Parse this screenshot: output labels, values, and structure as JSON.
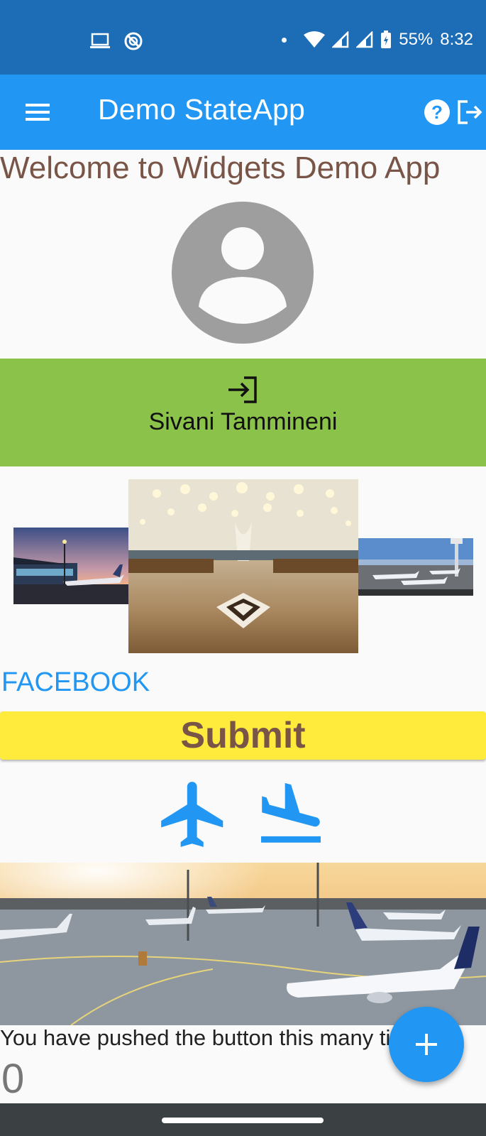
{
  "status_bar": {
    "battery": "55%",
    "time": "8:32",
    "icons": [
      "laptop-icon",
      "sync-disabled-icon",
      "notification-dot-icon",
      "wifi-icon",
      "signal-icon",
      "signal-icon",
      "battery-icon"
    ]
  },
  "app_bar": {
    "title": "Demo StateApp",
    "icons": [
      "menu-icon",
      "help-icon",
      "logout-icon"
    ]
  },
  "welcome_text": "Welcome to Widgets Demo App",
  "login_card": {
    "icon": "login-icon",
    "name": "Sivani Tammineni"
  },
  "link_text": "FACEBOOK",
  "submit_label": "Submit",
  "flight_icons": [
    "airplane-icon",
    "flight-land-icon"
  ],
  "counter": {
    "label": "You have pushed the button this many times:",
    "value": "0"
  },
  "fab_icon": "plus-icon",
  "colors": {
    "status_bar": "#1c6db6",
    "app_bar": "#2196f3",
    "welcome_text": "#795548",
    "login_card": "#8bc34a",
    "submit_bg": "#ffeb3b",
    "submit_text": "#795548",
    "link": "#2196f3",
    "fab": "#2196f3",
    "nav_bar": "#3b4043"
  }
}
